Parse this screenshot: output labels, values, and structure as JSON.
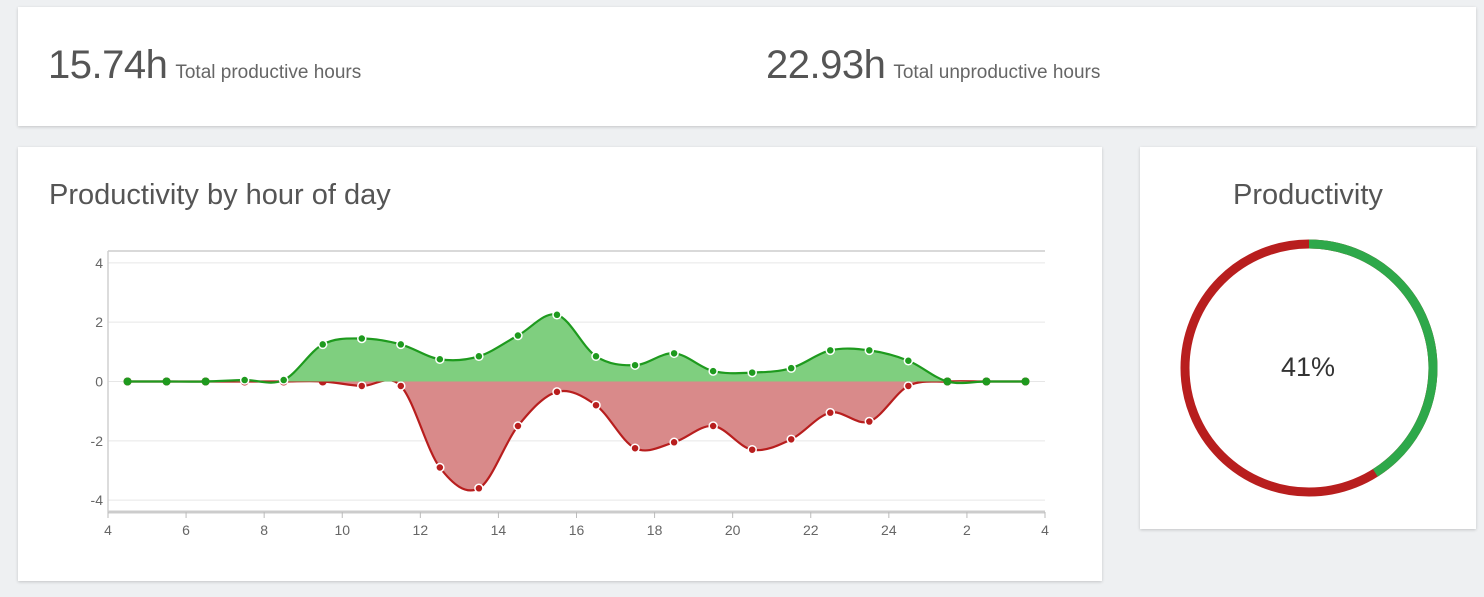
{
  "summary": {
    "productive": {
      "value": "15.74h",
      "label": "Total productive hours"
    },
    "unproductive": {
      "value": "22.93h",
      "label": "Total unproductive hours"
    }
  },
  "chart": {
    "title": "Productivity by hour of day"
  },
  "donut": {
    "title": "Productivity",
    "value_label": "41%",
    "productive_fraction": 0.41
  },
  "colors": {
    "productive_line": "#1e9a1e",
    "productive_fill": "#7fcf7f",
    "unproductive_line": "#b81e1e",
    "unproductive_fill": "#d98a8a",
    "donut_productive": "#2ea84a",
    "donut_unproductive": "#b81e1e"
  },
  "chart_data": {
    "type": "area",
    "title": "Productivity by hour of day",
    "xlabel": "",
    "ylabel": "",
    "ylim": [
      -4.4,
      4.4
    ],
    "y_ticks": [
      4,
      2,
      0,
      -2,
      -4
    ],
    "x_ticks": [
      "4",
      "6",
      "8",
      "10",
      "12",
      "14",
      "16",
      "18",
      "20",
      "22",
      "24",
      "2",
      "4"
    ],
    "x": [
      4.5,
      5.5,
      6.5,
      7.5,
      8.5,
      9.5,
      10.5,
      11.5,
      12.5,
      13.5,
      14.5,
      15.5,
      16.5,
      17.5,
      18.5,
      19.5,
      20.5,
      21.5,
      22.5,
      23.5,
      24.5,
      25.5,
      26.5,
      27.5
    ],
    "xlim": [
      4,
      28
    ],
    "grid": true,
    "series": [
      {
        "key": "productive",
        "values": [
          0,
          0,
          0,
          0.05,
          0.05,
          1.25,
          1.45,
          1.25,
          0.75,
          0.85,
          1.55,
          2.25,
          0.85,
          0.55,
          0.95,
          0.35,
          0.3,
          0.45,
          1.05,
          1.05,
          0.7,
          0,
          0,
          0
        ]
      },
      {
        "key": "unproductive",
        "values": [
          0,
          0,
          0,
          0,
          0,
          0,
          -0.15,
          -0.15,
          -2.9,
          -3.6,
          -1.5,
          -0.35,
          -0.8,
          -2.25,
          -2.05,
          -1.5,
          -2.3,
          -1.95,
          -1.05,
          -1.35,
          -0.15,
          0,
          0,
          0
        ]
      }
    ]
  }
}
